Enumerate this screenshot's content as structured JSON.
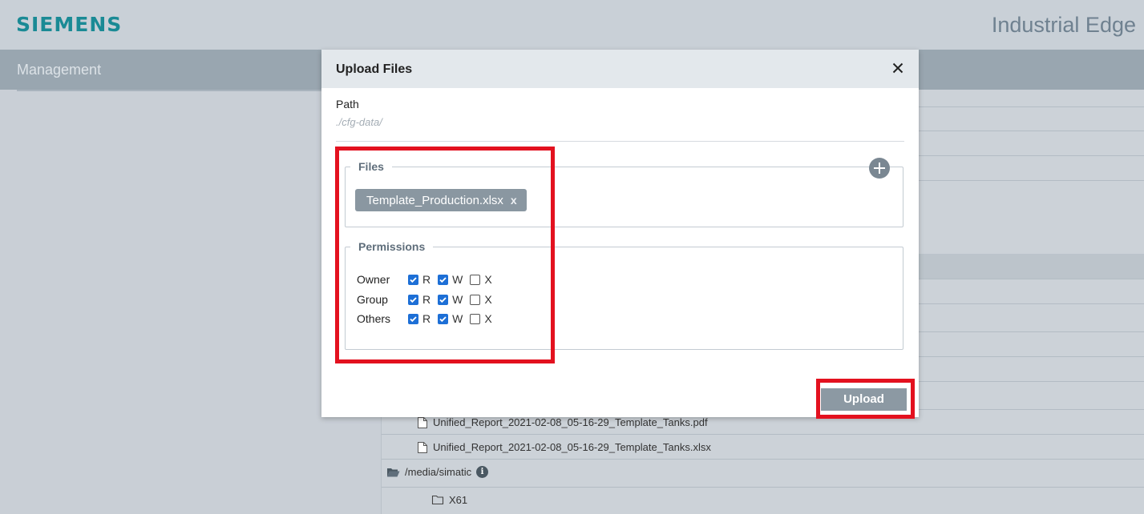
{
  "header": {
    "brand": "SIEMENS",
    "product": "Industrial Edge"
  },
  "nav": {
    "section": "Management"
  },
  "file_list": {
    "rows": [
      {
        "type": "file",
        "name": "Unified_Report_2021-02-08_05-16-29_Template_Tanks.pdf"
      },
      {
        "type": "file",
        "name": "Unified_Report_2021-02-08_05-16-29_Template_Tanks.xlsx"
      },
      {
        "type": "folder-open",
        "name": "/media/simatic",
        "info_icon": "info-icon"
      },
      {
        "type": "folder",
        "name": "X61"
      }
    ]
  },
  "dialog": {
    "title": "Upload Files",
    "close_icon": "close-icon",
    "path_label": "Path",
    "path_value": "./cfg-data/",
    "files_legend": "Files",
    "add_icon": "plus-circle-icon",
    "file_chip": {
      "name": "Template_Production.xlsx",
      "remove": "x"
    },
    "permissions_legend": "Permissions",
    "permissions": [
      {
        "role": "Owner",
        "r": true,
        "w": true,
        "x": false
      },
      {
        "role": "Group",
        "r": true,
        "w": true,
        "x": false
      },
      {
        "role": "Others",
        "r": true,
        "w": true,
        "x": false
      }
    ],
    "perm_labels": {
      "r": "R",
      "w": "W",
      "x": "X"
    },
    "upload_label": "Upload"
  },
  "colors": {
    "brand": "#1a8a95",
    "highlight": "#e3111f",
    "checkbox_checked": "#1d6fd6",
    "button": "#8c99a3"
  }
}
